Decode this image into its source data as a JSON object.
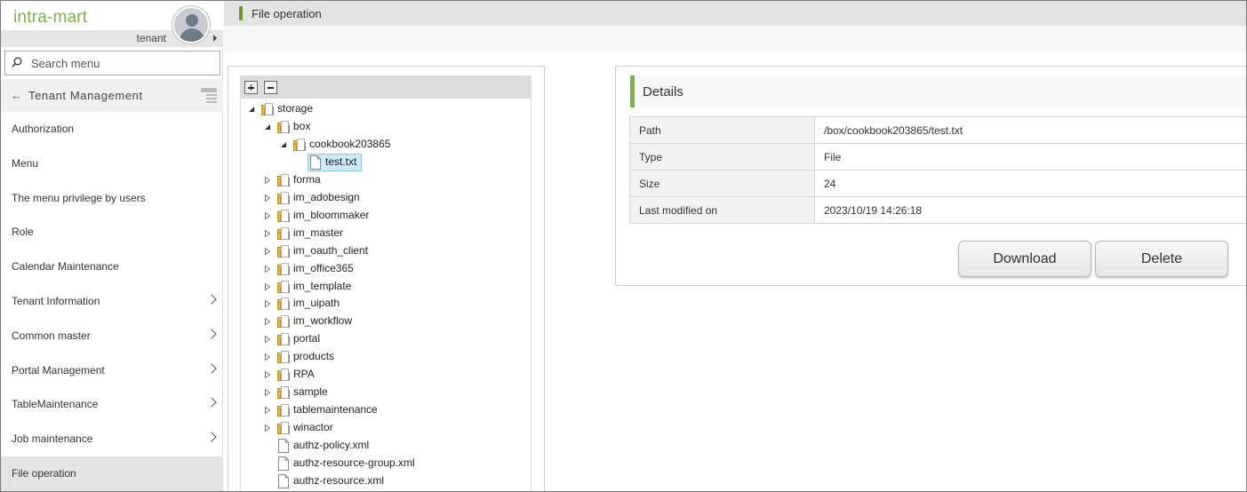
{
  "brand": {
    "logo": "intra-mart",
    "tenant": "tenant"
  },
  "search": {
    "placeholder": "Search menu"
  },
  "nav": {
    "back_label": "Tenant Management",
    "items": [
      {
        "label": "Authorization",
        "has_children": false
      },
      {
        "label": "Menu",
        "has_children": false
      },
      {
        "label": "The menu privilege by users",
        "has_children": false
      },
      {
        "label": "Role",
        "has_children": false
      },
      {
        "label": "Calendar Maintenance",
        "has_children": false
      },
      {
        "label": "Tenant Information",
        "has_children": true
      },
      {
        "label": "Common master",
        "has_children": true
      },
      {
        "label": "Portal Management",
        "has_children": true
      },
      {
        "label": "TableMaintenance",
        "has_children": true
      },
      {
        "label": "Job maintenance",
        "has_children": true
      },
      {
        "label": "File operation",
        "has_children": false,
        "active": true
      }
    ]
  },
  "header": {
    "title": "File operation"
  },
  "tree": {
    "toolbar": {
      "expand_icon": "plus-icon",
      "collapse_icon": "minus-icon"
    },
    "nodes": [
      {
        "label": "storage",
        "type": "folder",
        "depth": 0,
        "state": "open"
      },
      {
        "label": "box",
        "type": "folder",
        "depth": 1,
        "state": "open"
      },
      {
        "label": "cookbook203865",
        "type": "folder",
        "depth": 2,
        "state": "open"
      },
      {
        "label": "test.txt",
        "type": "file",
        "depth": 3,
        "selected": true
      },
      {
        "label": "forma",
        "type": "folder",
        "depth": 1,
        "state": "closed"
      },
      {
        "label": "im_adobesign",
        "type": "folder",
        "depth": 1,
        "state": "closed"
      },
      {
        "label": "im_bloommaker",
        "type": "folder",
        "depth": 1,
        "state": "closed"
      },
      {
        "label": "im_master",
        "type": "folder",
        "depth": 1,
        "state": "closed"
      },
      {
        "label": "im_oauth_client",
        "type": "folder",
        "depth": 1,
        "state": "closed"
      },
      {
        "label": "im_office365",
        "type": "folder",
        "depth": 1,
        "state": "closed"
      },
      {
        "label": "im_template",
        "type": "folder",
        "depth": 1,
        "state": "closed"
      },
      {
        "label": "im_uipath",
        "type": "folder",
        "depth": 1,
        "state": "closed"
      },
      {
        "label": "im_workflow",
        "type": "folder",
        "depth": 1,
        "state": "closed"
      },
      {
        "label": "portal",
        "type": "folder",
        "depth": 1,
        "state": "closed"
      },
      {
        "label": "products",
        "type": "folder",
        "depth": 1,
        "state": "closed"
      },
      {
        "label": "RPA",
        "type": "folder",
        "depth": 1,
        "state": "closed"
      },
      {
        "label": "sample",
        "type": "folder",
        "depth": 1,
        "state": "closed"
      },
      {
        "label": "tablemaintenance",
        "type": "folder",
        "depth": 1,
        "state": "closed"
      },
      {
        "label": "winactor",
        "type": "folder",
        "depth": 1,
        "state": "closed"
      },
      {
        "label": "authz-policy.xml",
        "type": "file",
        "depth": 1
      },
      {
        "label": "authz-resource-group.xml",
        "type": "file",
        "depth": 1
      },
      {
        "label": "authz-resource.xml",
        "type": "file",
        "depth": 1
      }
    ]
  },
  "details": {
    "title": "Details",
    "rows": [
      {
        "key": "Path",
        "value": "/box/cookbook203865/test.txt"
      },
      {
        "key": "Type",
        "value": "File"
      },
      {
        "key": "Size",
        "value": "24"
      },
      {
        "key": "Last modified on",
        "value": "2023/10/19 14:26:18"
      }
    ],
    "download_label": "Download",
    "delete_label": "Delete"
  },
  "colors": {
    "brand_green": "#7cb342",
    "header_marker": "#6a9a2e",
    "selection": "#cde8f6"
  }
}
